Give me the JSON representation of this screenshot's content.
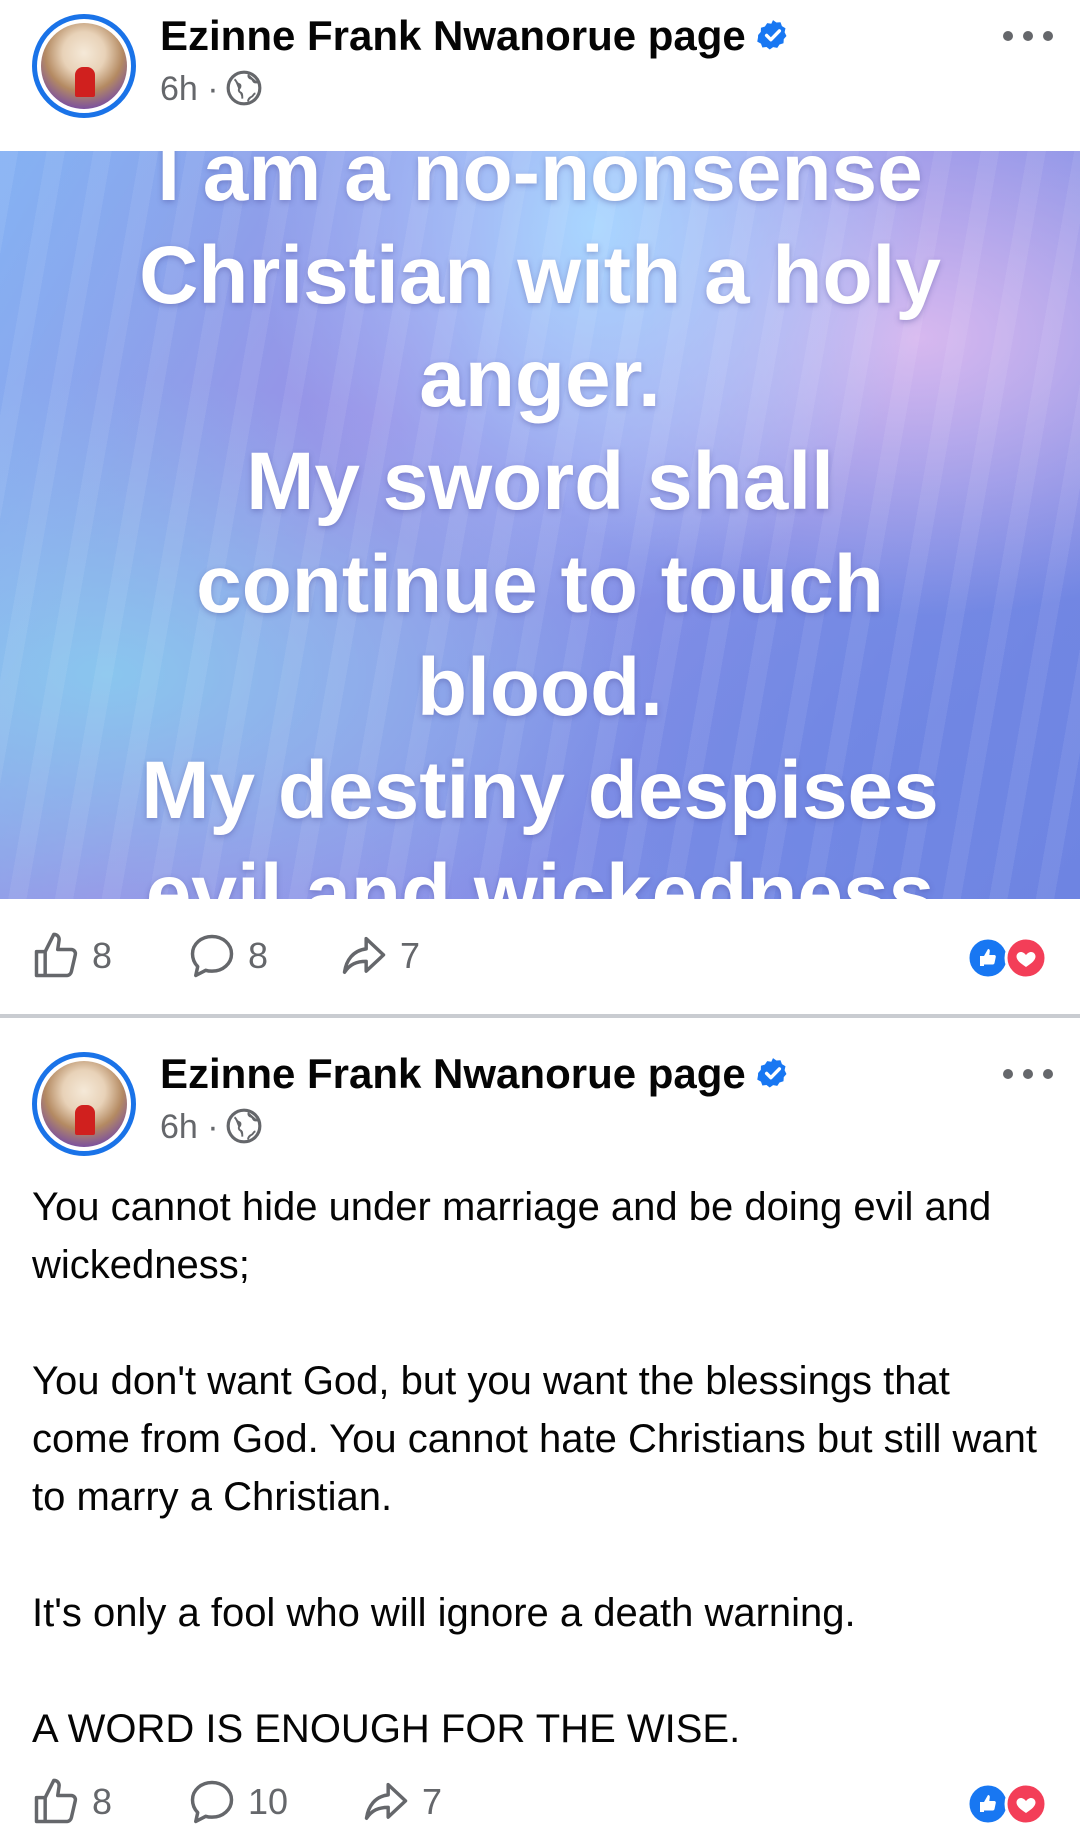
{
  "posts": [
    {
      "author": "Ezinne Frank Nwanorue page",
      "time": "6h",
      "separator": "·",
      "background_text_lines": [
        "I am a no-nonsense",
        "Christian with a holy",
        "anger.",
        "My sword shall",
        "continue to touch",
        "blood.",
        "My destiny despises",
        "evil and wickedness"
      ],
      "likes": "8",
      "comments": "8",
      "shares": "7"
    },
    {
      "author": "Ezinne Frank Nwanorue page",
      "time": "6h",
      "separator": "·",
      "paragraphs": [
        "You cannot hide under marriage and be doing evil and wickedness;",
        "You don't want God, but you want the blessings that come from God. You cannot hate Christians but still want to marry a Christian.",
        "It's only a fool who will ignore a death warning.",
        "A WORD IS ENOUGH FOR THE WISE."
      ],
      "likes": "8",
      "comments": "10",
      "shares": "7"
    }
  ],
  "icons": {
    "verified": "verified-badge-icon",
    "audience": "globe-icon",
    "more": "more-options-icon",
    "like": "thumbs-up-icon",
    "comment": "comment-icon",
    "share": "share-icon",
    "reactions": [
      "like-reaction-icon",
      "love-reaction-icon"
    ]
  },
  "colors": {
    "brand_blue": "#1877f2",
    "love_red": "#f33e58",
    "meta_gray": "#65676b",
    "divider": "#c9ccd1"
  }
}
